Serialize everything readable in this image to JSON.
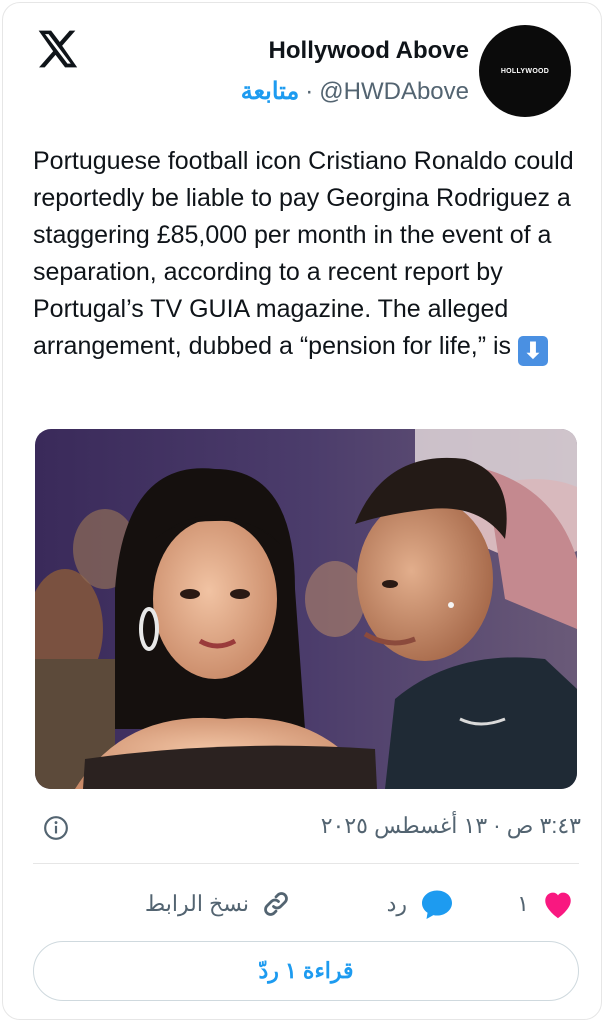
{
  "author": {
    "name": "Hollywood Above",
    "handle": "@HWDAbove",
    "separator": "·",
    "follow_label": "متابعة",
    "avatar_text": "HOLLYWOOD"
  },
  "tweet": {
    "text": "Portuguese football icon Cristiano Ronaldo could reportedly be liable to pay Georgina Rodriguez a staggering £85,000 per month in the event of a separation, according to a recent report by Portugal’s TV GUIA magazine. The alleged arrangement, dubbed a “pension for life,” is",
    "emoji_icon": "down-arrow-emoji",
    "emoji_glyph": "⬇"
  },
  "meta": {
    "timestamp": "٣:٤٣ ص · ١٣ أغسطس ٢٠٢٥",
    "info_icon": "info-icon"
  },
  "actions": {
    "like_count": "١",
    "reply_label": "رد",
    "copy_link_label": "نسخ الرابط"
  },
  "read_replies_label": "قراءة ١ ردّ",
  "colors": {
    "accent": "#1d9bf0",
    "like": "#f91880",
    "text_primary": "#0f1419",
    "text_secondary": "#536471"
  }
}
